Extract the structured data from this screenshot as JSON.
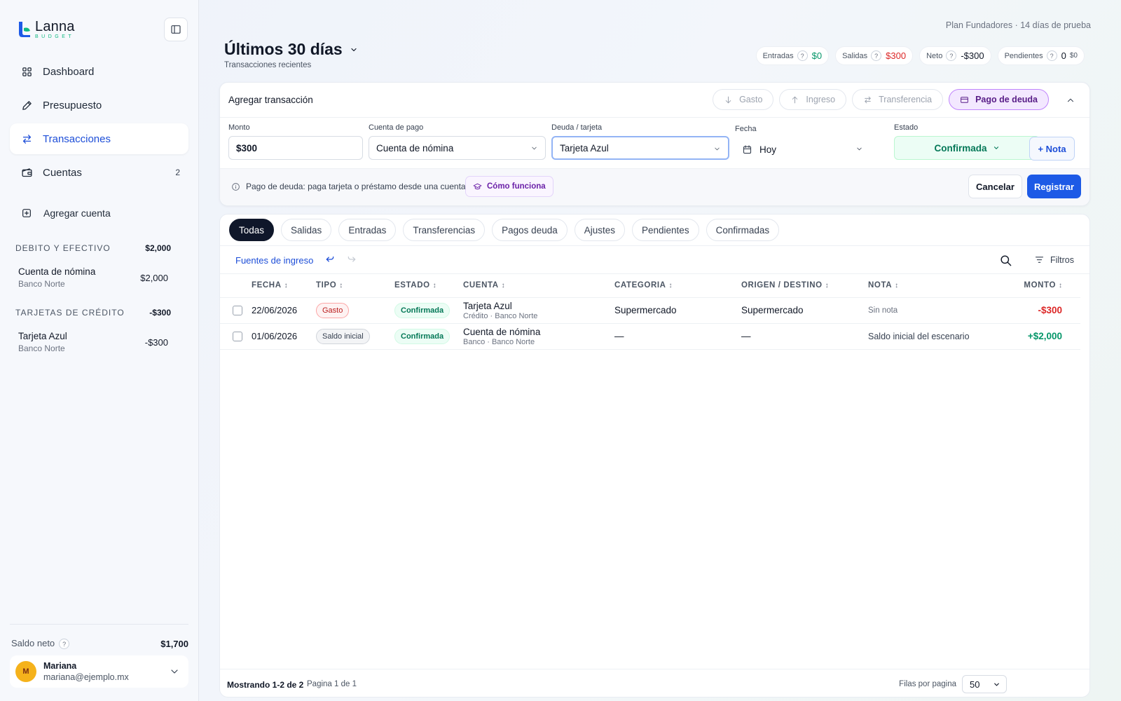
{
  "colors": {
    "accent": "#1d5ae6",
    "brand_green": "#10b981",
    "positive": "#059669",
    "negative": "#dc2626",
    "debt_purple": "#c084fc"
  },
  "brand": {
    "name": "Lanna",
    "sub": "BUDGET"
  },
  "sidebar": {
    "nav": [
      {
        "label": "Dashboard",
        "icon": "grid-icon"
      },
      {
        "label": "Presupuesto",
        "icon": "pencil-icon"
      },
      {
        "label": "Transacciones",
        "icon": "arrows-exchange-icon",
        "active": true
      },
      {
        "label": "Cuentas",
        "icon": "wallet-icon",
        "count": "2"
      }
    ],
    "add_account": "Agregar cuenta",
    "groups": [
      {
        "title": "DEBITO Y EFECTIVO",
        "total": "$2,000",
        "accounts": [
          {
            "name": "Cuenta de nómina",
            "bank": "Banco Norte",
            "balance": "$2,000"
          }
        ]
      },
      {
        "title": "TARJETAS DE CRÉDITO",
        "total": "-$300",
        "accounts": [
          {
            "name": "Tarjeta Azul",
            "bank": "Banco Norte",
            "balance": "-$300"
          }
        ]
      }
    ],
    "net_label": "Saldo neto",
    "net_value": "$1,700",
    "user": {
      "initial": "M",
      "name": "Mariana",
      "email": "mariana@ejemplo.mx"
    }
  },
  "header": {
    "plan": "Plan Fundadores  ·  14 días de prueba",
    "title": "Últimos 30 días",
    "subtitle": "Transacciones recientes",
    "kpis": {
      "entradas": {
        "label": "Entradas",
        "value": "$0"
      },
      "salidas": {
        "label": "Salidas",
        "value": "$300"
      },
      "neto": {
        "label": "Neto",
        "value": "-$300"
      },
      "pendientes": {
        "label": "Pendientes",
        "value": "0",
        "sub": "$0"
      }
    }
  },
  "add": {
    "title": "Agregar transacción",
    "types": {
      "gasto": "Gasto",
      "ingreso": "Ingreso",
      "transferencia": "Transferencia",
      "pago": "Pago de deuda"
    },
    "fields": {
      "monto": {
        "label": "Monto",
        "value": "$300"
      },
      "cuenta": {
        "label": "Cuenta de pago",
        "value": "Cuenta de nómina"
      },
      "deuda": {
        "label": "Deuda / tarjeta",
        "value": "Tarjeta Azul"
      },
      "fecha": {
        "label": "Fecha",
        "value": "Hoy"
      },
      "estado": {
        "label": "Estado",
        "value": "Confirmada"
      }
    },
    "nota": "+ Nota",
    "info": "Pago de deuda: paga tarjeta o préstamo desde una cuenta",
    "how": "Cómo funciona",
    "cancel": "Cancelar",
    "submit": "Registrar"
  },
  "list": {
    "tabs": [
      "Todas",
      "Salidas",
      "Entradas",
      "Transferencias",
      "Pagos deuda",
      "Ajustes",
      "Pendientes",
      "Confirmadas"
    ],
    "sources_link": "Fuentes de ingreso",
    "filters": "Filtros",
    "columns": {
      "fecha": "FECHA",
      "tipo": "TIPO",
      "estado": "ESTADO",
      "cuenta": "CUENTA",
      "categoria": "CATEGORIA",
      "origen": "ORIGEN / DESTINO",
      "nota": "NOTA",
      "monto": "MONTO"
    },
    "rows": [
      {
        "fecha": "22/06/2026",
        "tipo": "Gasto",
        "estado": "Confirmada",
        "cuenta": "Tarjeta Azul",
        "cuenta_sub": "Crédito · Banco Norte",
        "categoria": "Supermercado",
        "origen": "Supermercado",
        "nota": "Sin nota",
        "monto": "-$300"
      },
      {
        "fecha": "01/06/2026",
        "tipo": "Saldo inicial",
        "estado": "Confirmada",
        "cuenta": "Cuenta de nómina",
        "cuenta_sub": "Banco · Banco Norte",
        "categoria": "—",
        "origen": "—",
        "nota": "Saldo inicial del escenario",
        "monto": "+$2,000"
      }
    ],
    "showing": "Mostrando 1-2 de 2",
    "page_info": "Pagina 1 de 1",
    "rows_label": "Filas por pagina",
    "rows_value": "50"
  }
}
